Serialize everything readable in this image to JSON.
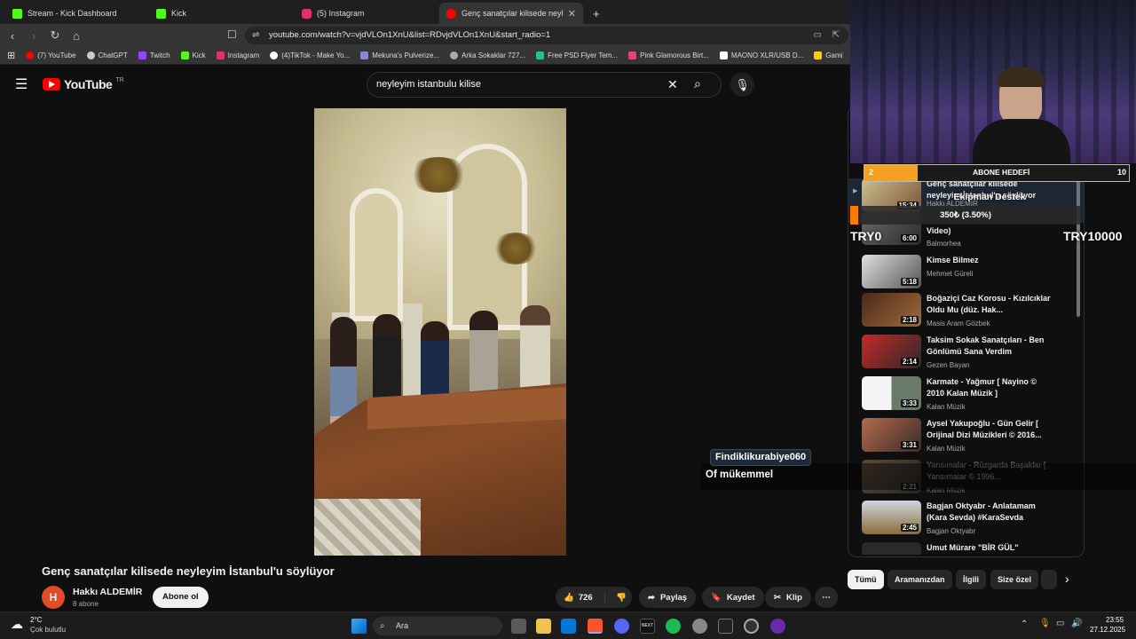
{
  "browser": {
    "tabs": [
      {
        "label": "Stream - Kick Dashboard",
        "color": "#53fc18"
      },
      {
        "label": "Kick",
        "color": "#53fc18"
      },
      {
        "label": "(5) Instagram",
        "color": "#e1306c"
      },
      {
        "label": "Genç sanatçılar kilisede neyleyim",
        "color": "#ff0000"
      }
    ],
    "url": "youtube.com/watch?v=vjdVLOn1XnU&list=RDvjdVLOn1XnU&start_radio=1",
    "bookmarks": [
      {
        "label": "(7) YouTube",
        "color": "#ff0000"
      },
      {
        "label": "ChatGPT",
        "color": "#cccccc"
      },
      {
        "label": "Twitch",
        "color": "#9146ff"
      },
      {
        "label": "Kick",
        "color": "#53fc18"
      },
      {
        "label": "Instagram",
        "color": "#e1306c"
      },
      {
        "label": "(4)TikTok - Make Yo...",
        "color": "#ffffff"
      },
      {
        "label": "Mekuna's Pulverize...",
        "color": "#8888cc"
      },
      {
        "label": "Arka Sokaklar 727...",
        "color": "#aaaaaa"
      },
      {
        "label": "Free PSD Flyer Tem...",
        "color": "#2bbf8a"
      },
      {
        "label": "Pink Glamorous Birt...",
        "color": "#e0457b"
      },
      {
        "label": "MAONO XLR/USB D...",
        "color": "#ffffff"
      },
      {
        "label": "Gami",
        "color": "#ffcc00"
      }
    ]
  },
  "youtube": {
    "logo": "YouTube",
    "region": "TR",
    "search_value": "neyleyim istanbulu kilise",
    "video_title": "Genç sanatçılar kilisede neyleyim İstanbul'u söylüyor",
    "channel": {
      "initial": "H",
      "name": "Hakkı ALDEMİR",
      "subs": "8 abone",
      "subscribe_label": "Abone ol"
    },
    "actions": {
      "likes": "726",
      "share": "Paylaş",
      "save": "Kaydet",
      "clip": "Klip"
    },
    "chips": [
      "Tümü",
      "Aramanızdan",
      "İlgili",
      "Size özel"
    ]
  },
  "playlist": [
    {
      "title": "Genç sanatçılar kilisede neyleyim İstanbul'u söylüyor",
      "channel": "Hakkı ALDEMİR",
      "duration": "15:34"
    },
    {
      "title": "Video)",
      "channel": "Balmorhea",
      "duration": "6:00"
    },
    {
      "title": "Kimse Bilmez",
      "channel": "Mehmet Güreli",
      "duration": "5:18"
    },
    {
      "title": "Boğaziçi Caz Korosu - Kızılcıklar Oldu Mu (düz. Hak...",
      "channel": "Masis Aram Gözbek",
      "duration": "2:18"
    },
    {
      "title": "Taksim Sokak Sanatçıları - Ben Gönlümü Sana Verdim",
      "channel": "Gezen Bayan",
      "duration": "2:14"
    },
    {
      "title": "Karmate - Yağmur [ Nayino © 2010 Kalan Müzik ]",
      "channel": "Kalan Müzik",
      "duration": "3:33"
    },
    {
      "title": "Aysel Yakupoğlu - Gün Gelir [ Orijinal Dizi Müzikleri © 2016...",
      "channel": "Kalan Müzik",
      "duration": "3:31"
    },
    {
      "title": "Yansımalar - Rüzgarda Başaklar [ Yansımalar © 1996...",
      "channel": "Kalan Müzik",
      "duration": "2:21"
    },
    {
      "title": "Bagjan Oktyabr - Anlatamam (Kara Sevda) #KaraSevda",
      "channel": "Bagjan Oktyabr",
      "duration": "2:45"
    },
    {
      "title": "Umut Mürare \"BİR GÜL\"",
      "channel": "",
      "duration": ""
    }
  ],
  "overlay": {
    "goal_label": "ABONE HEDEFİ",
    "goal_current": "2",
    "goal_target": "10",
    "donation_title": "Ekipman Destek",
    "donation_amount": "350₺ (3.50%)",
    "donation_min": "TRY0",
    "donation_max": "TRY10000",
    "chat_user": "Findiklikurabiye060",
    "chat_message": "Of mükemmel"
  },
  "taskbar": {
    "weather_temp": "2°C",
    "weather_desc": "Çok bulutlu",
    "search_label": "Ara",
    "time": "23:55",
    "date": "27.12.2025"
  }
}
